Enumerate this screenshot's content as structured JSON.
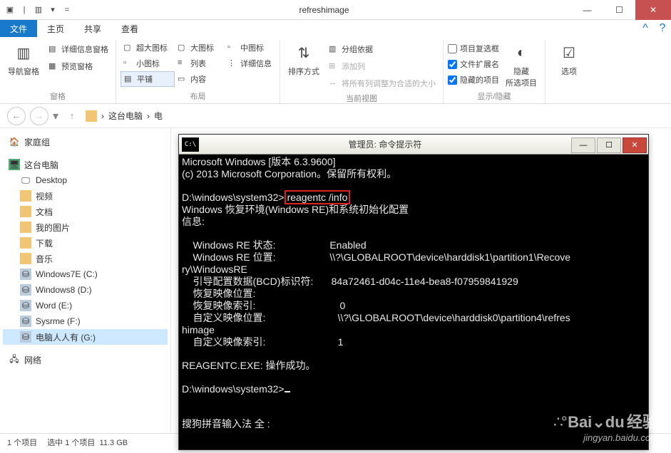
{
  "window": {
    "title": "refreshimage"
  },
  "tabs": {
    "file": "文件",
    "home": "主页",
    "share": "共享",
    "view": "查看"
  },
  "ribbon": {
    "group_panes": "窗格",
    "nav_pane": "导航窗格",
    "detail_pane": "详细信息窗格",
    "preview_pane": "预览窗格",
    "group_layout": "布局",
    "xl_icons": "超大图标",
    "l_icons": "大图标",
    "m_icons": "中图标",
    "s_icons": "小图标",
    "list": "列表",
    "details": "详细信息",
    "tiles": "平铺",
    "content": "内容",
    "group_current": "当前视图",
    "sort_by": "排序方式",
    "group_by": "分组依据",
    "add_cols": "添加列",
    "autosize": "将所有列调整为合适的大小",
    "group_show": "显示/隐藏",
    "item_chk": "项目复选框",
    "file_ext": "文件扩展名",
    "hidden_items": "隐藏的项目",
    "hide_sel": "隐藏\n所选项目",
    "options": "选项"
  },
  "breadcrumb": {
    "root": "这台电脑",
    "sep": "›",
    "drive_cut": "电"
  },
  "tree": {
    "homegroup": "家庭组",
    "thispc": "这台电脑",
    "desktop": "Desktop",
    "videos": "视频",
    "documents": "文档",
    "pictures": "我的图片",
    "downloads": "下载",
    "music": "音乐",
    "drive_c": "Windows7E (C:)",
    "drive_d": "Windows8 (D:)",
    "drive_e": "Word (E:)",
    "drive_f": "Sysrme (F:)",
    "drive_g": "电脑人人有 (G:)",
    "network": "网络"
  },
  "status": {
    "count": "1 个项目",
    "selected": "选中 1 个项目",
    "size": "11.3 GB"
  },
  "cmd": {
    "title": "管理员: 命令提示符",
    "icon_text": "C:\\",
    "line1": "Microsoft Windows [版本 6.3.9600]",
    "line2": "(c) 2013 Microsoft Corporation。保留所有权利。",
    "prompt1": "D:\\windows\\system32>",
    "command": "reagentc /info",
    "line3": "Windows 恢复环境(Windows RE)和系统初始化配置",
    "line4": "信息:",
    "re_state_l": "    Windows RE 状态:",
    "re_state_v": "Enabled",
    "re_loc_l": "    Windows RE 位置:",
    "re_loc_v": "\\\\?\\GLOBALROOT\\device\\harddisk1\\partition1\\Recove",
    "re_loc_wrap": "ry\\WindowsRE",
    "bcd_l": "    引导配置数据(BCD)标识符:",
    "bcd_v": "84a72461-d04c-11e4-bea8-f07959841929",
    "rimg_l": "    恢复映像位置:",
    "rimg_idx_l": "    恢复映像索引:",
    "rimg_idx_v": "0",
    "cust_l": "    自定义映像位置:",
    "cust_v": "\\\\?\\GLOBALROOT\\device\\harddisk0\\partition4\\refres",
    "cust_wrap": "himage",
    "cust_idx_l": "    自定义映像索引:",
    "cust_idx_v": "1",
    "result": "REAGENTC.EXE: 操作成功。",
    "prompt2": "D:\\windows\\system32>",
    "ime": "搜狗拼音输入法 全 :"
  },
  "watermark": {
    "brand_a": "Bai",
    "brand_b": "du",
    "brand_c": "经验",
    "url": "jingyan.baidu.com"
  }
}
